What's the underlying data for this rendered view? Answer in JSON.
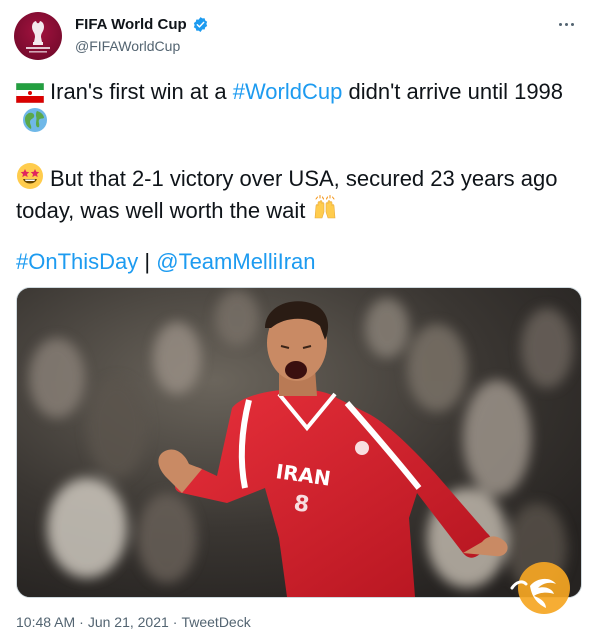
{
  "header": {
    "display_name": "FIFA World Cup",
    "handle": "@FIFAWorldCup",
    "avatar_icon": "fifa-world-cup-qatar-2022-logo",
    "avatar_logo_text": "FIFA WORLD CUP Qatar2022",
    "verified_icon": "verified-badge-icon",
    "more_icon": "more-options-icon"
  },
  "tweet": {
    "line1_flag": "iran-flag-emoji",
    "line1_text_a": "Iran's first win at a ",
    "line1_hashtag": "#WorldCup",
    "line1_text_b": " didn't arrive until 1998",
    "line1_emoji": "globe-emoji",
    "line2_emoji": "star-struck-emoji",
    "line2_text": "But that 2-1 victory over USA, secured 23 years ago today, was well worth the wait",
    "line2_end_emoji": "raising-hands-emoji",
    "hashtag_onthisday": "#OnThisDay",
    "divider": " | ",
    "mention": "@TeamMelliIran"
  },
  "media": {
    "photo_subject": "iran-player-celebrating-photo",
    "jersey_text": "IRAN"
  },
  "footer": {
    "time": "10:48 AM",
    "separator": "·",
    "date": "Jun 21, 2021",
    "source": "TweetDeck"
  },
  "colors": {
    "link": "#1d9bf0",
    "text": "#0f1419",
    "secondary": "#536471",
    "jersey_red": "#d3202b",
    "watermark_orange": "#f5a623"
  }
}
